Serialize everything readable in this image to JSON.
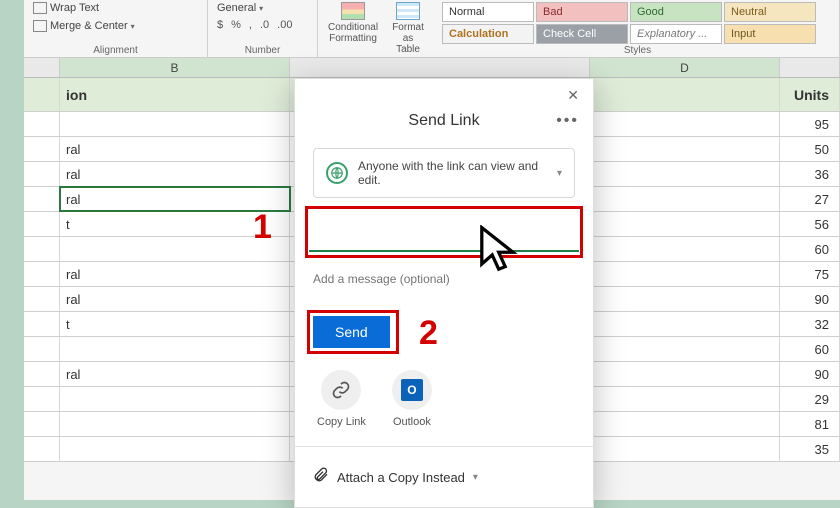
{
  "ribbon": {
    "wrap_text": "Wrap Text",
    "merge_center": "Merge & Center",
    "alignment_label": "Alignment",
    "number_label": "Number",
    "number_format": "General",
    "currency": "$",
    "percent": "%",
    "comma": ",",
    "inc_dec": ".0",
    "dec_dec": ".00",
    "conditional": "Conditional\nFormatting",
    "format_table": "Format as\nTable",
    "styles_label": "Styles",
    "styles": {
      "normal": "Normal",
      "bad": "Bad",
      "good": "Good",
      "neutral": "Neutral",
      "calculation": "Calculation",
      "check_cell": "Check Cell",
      "explanatory": "Explanatory ...",
      "input": "Input"
    }
  },
  "columns": {
    "b": "B",
    "d": "D"
  },
  "sheet": {
    "header_b": "ion",
    "header_e": "Units",
    "rows": [
      {
        "b": "",
        "e": "95"
      },
      {
        "b": "ral",
        "e": "50"
      },
      {
        "b": "ral",
        "e": "36"
      },
      {
        "b": "ral",
        "e": "27"
      },
      {
        "b": "t",
        "e": "56"
      },
      {
        "b": "",
        "e": "60"
      },
      {
        "b": "ral",
        "e": "75"
      },
      {
        "b": "ral",
        "e": "90"
      },
      {
        "b": "t",
        "e": "32"
      },
      {
        "b": "",
        "e": "60"
      },
      {
        "b": "ral",
        "e": "90"
      },
      {
        "b": "",
        "e": "29"
      },
      {
        "b": "",
        "e": "81"
      },
      {
        "b": "",
        "e": "35"
      }
    ]
  },
  "dialog": {
    "title": "Send Link",
    "permission": "Anyone with the link can view and edit.",
    "recipient_placeholder": "",
    "message_placeholder": "Add a message (optional)",
    "send": "Send",
    "copy_link": "Copy Link",
    "outlook": "Outlook",
    "attach": "Attach a Copy Instead"
  },
  "annotations": {
    "one": "1",
    "two": "2"
  }
}
